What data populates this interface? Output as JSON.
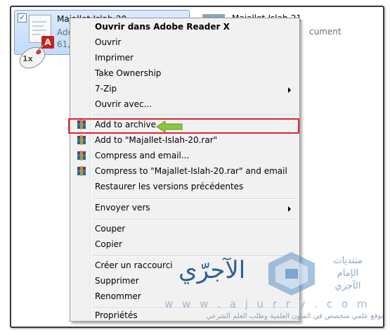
{
  "files": {
    "selected": {
      "name": "Majallet-Islah-20",
      "type_partial": "Ado",
      "size_partial": "61,9",
      "checkbox_mark": "✓",
      "badge_glyph": "A"
    },
    "other": {
      "name": "Majallet-Islah-21",
      "type_partial": "cument"
    }
  },
  "mouse_label": "1x",
  "context_menu": {
    "items": [
      {
        "label": "Ouvrir dans Adobe Reader X",
        "bold": true
      },
      {
        "label": "Ouvrir"
      },
      {
        "label": "Imprimer"
      },
      {
        "label": "Take Ownership"
      },
      {
        "label": "7-Zip",
        "submenu": true
      },
      {
        "label": "Ouvrir avec..."
      },
      {
        "label": "Add to archive...",
        "icon": "winrar-icon",
        "highlighted": true
      },
      {
        "label": "Add to \"Majallet-Islah-20.rar\"",
        "icon": "winrar-icon"
      },
      {
        "label": "Compress and email...",
        "icon": "winrar-icon"
      },
      {
        "label": "Compress to \"Majallet-Islah-20.rar\" and email",
        "icon": "winrar-icon"
      },
      {
        "label": "Restaurer les versions précédentes"
      },
      {
        "label": "Envoyer vers",
        "submenu": true
      },
      {
        "label": "Couper"
      },
      {
        "label": "Copier"
      },
      {
        "label": "Créer un raccourci"
      },
      {
        "label": "Supprimer"
      },
      {
        "label": "Renommer"
      },
      {
        "label": "Propriétés"
      }
    ]
  },
  "highlight_color": "#e0262d",
  "pointer_arrow_color": "#8cc63f",
  "watermark": {
    "title": "الآجرّي",
    "side_lines": [
      "منتديات",
      "الإمام",
      "الآجري"
    ],
    "url": "w w w . a j u r r y . c o m",
    "caption": "موقع علمي متخصص في المتون العلمية وطلب العلم الشرعي"
  }
}
